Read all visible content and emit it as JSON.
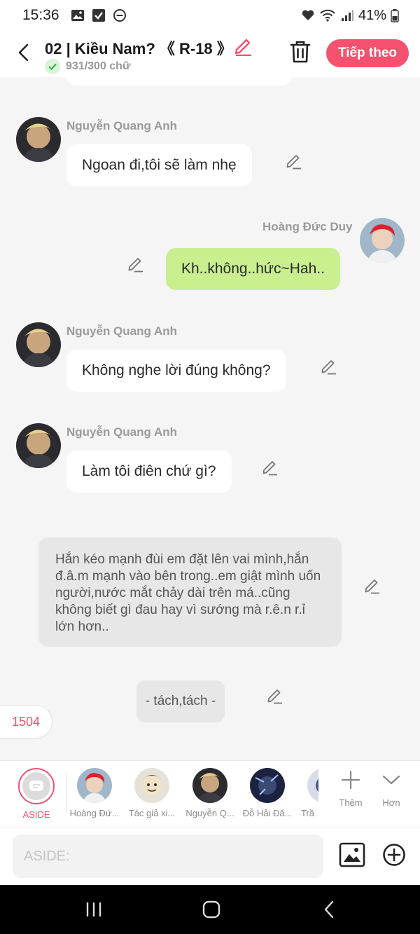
{
  "status_bar": {
    "time": "15:36",
    "battery": "41%"
  },
  "header": {
    "title": "02 | Kiều Nam? 《 R-18 》",
    "word_count": "931/300 chữ",
    "next_label": "Tiếp theo"
  },
  "messages": [
    {
      "sender": "Nguyễn Quang Anh",
      "text": "Ngoan đi,tôi sẽ làm nhẹ",
      "side": "left"
    },
    {
      "sender": "Hoàng Đức Duy",
      "text": "Kh..không..hức~Hah..",
      "side": "right"
    },
    {
      "sender": "Nguyễn Quang Anh",
      "text": "Không nghe lời đúng không?",
      "side": "left"
    },
    {
      "sender": "Nguyễn Quang Anh",
      "text": "Làm tôi điên chứ gì?",
      "side": "left"
    }
  ],
  "narration": "Hắn kéo mạnh đùi em đặt lên vai mình,hắn đ.â.m mạnh vào bên trong..em giật mình uốn người,nước mắt chảy dài trên má..cũng không biết gì đau hay vì sướng mà r.ê.n r.ỉ lớn hơn..",
  "sound_effect": "- tách,tách -",
  "counter": "1504",
  "characters": [
    {
      "label": "ASIDE"
    },
    {
      "label": "Hoàng Đứ..."
    },
    {
      "label": "Tác giả xi..."
    },
    {
      "label": "Nguyễn Q..."
    },
    {
      "label": "Đỗ Hải Đă..."
    },
    {
      "label": "Trầ"
    }
  ],
  "tools": {
    "more_label": "Thêm",
    "expand_label": "Hơn"
  },
  "input": {
    "placeholder": "ASIDE:"
  },
  "colors": {
    "accent": "#f6516e",
    "right_bubble": "#c9ef8f",
    "narration_bg": "#e7e7e7"
  }
}
